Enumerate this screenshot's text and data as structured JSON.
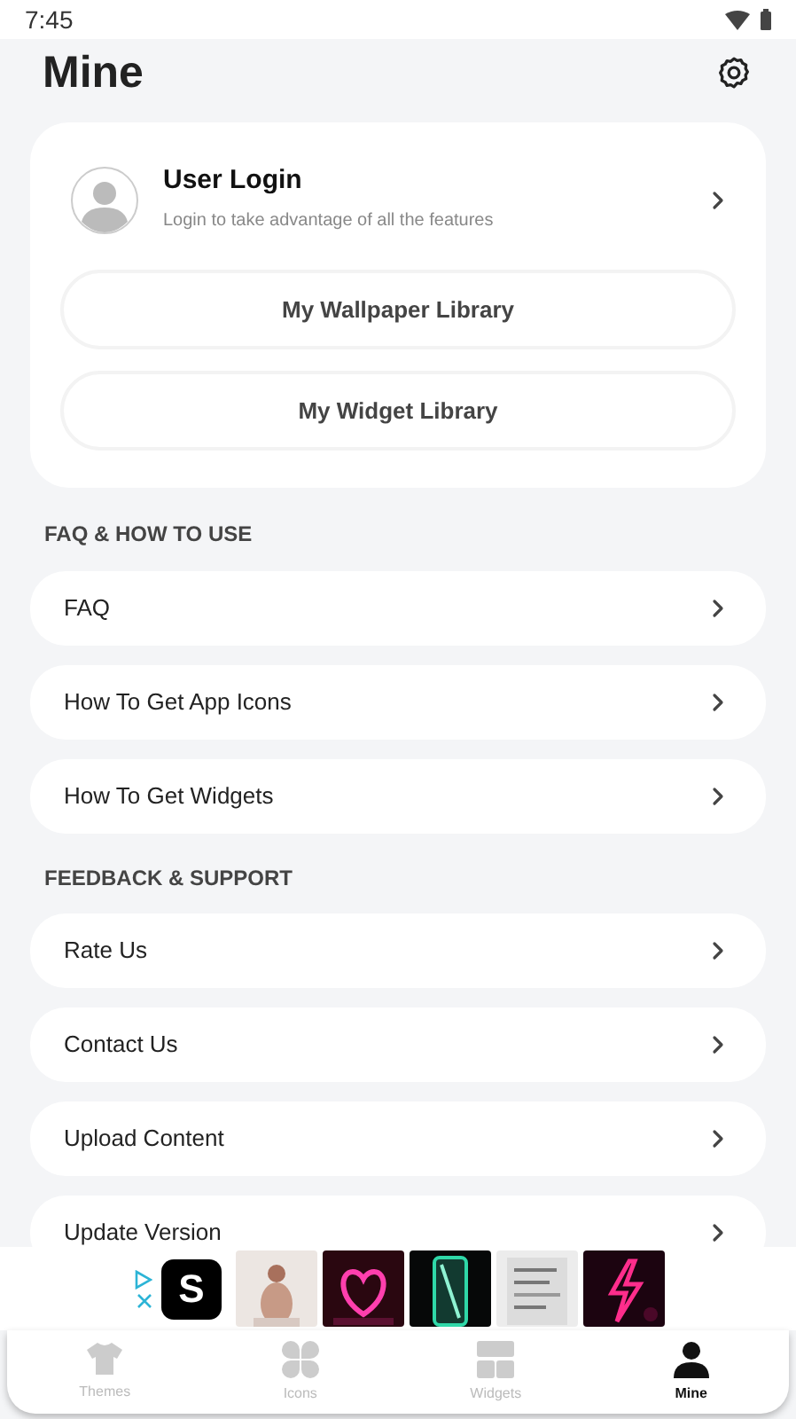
{
  "status_bar": {
    "time": "7:45"
  },
  "header": {
    "title": "Mine"
  },
  "account_card": {
    "title": "User Login",
    "subtitle": "Login to take advantage of all the features",
    "buttons": [
      "My Wallpaper Library",
      "My Widget Library"
    ]
  },
  "sections": [
    {
      "heading": "FAQ & HOW TO USE",
      "items": [
        {
          "label": "FAQ"
        },
        {
          "label": "How To Get App Icons"
        },
        {
          "label": "How To Get Widgets"
        }
      ]
    },
    {
      "heading": "FEEDBACK & SUPPORT",
      "items": [
        {
          "label": "Rate Us"
        },
        {
          "label": "Contact Us"
        },
        {
          "label": "Upload Content"
        },
        {
          "label": "Update Version"
        }
      ]
    }
  ],
  "ad": {
    "logo": "S"
  },
  "nav": [
    {
      "kind": "shirt",
      "label": "Themes",
      "selected": false
    },
    {
      "kind": "petals",
      "label": "Icons",
      "selected": false
    },
    {
      "kind": "tiles",
      "label": "Widgets",
      "selected": false
    },
    {
      "kind": "person",
      "label": "Mine",
      "selected": true
    }
  ]
}
